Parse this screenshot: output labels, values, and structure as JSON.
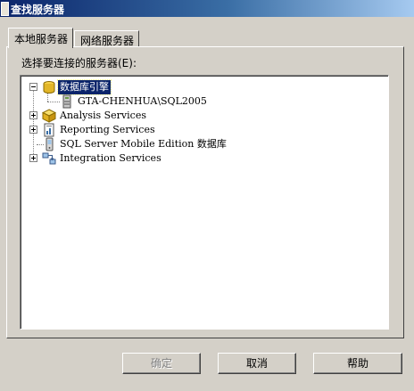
{
  "window": {
    "title": "查找服务器"
  },
  "tabs": [
    {
      "label": "本地服务器",
      "active": true
    },
    {
      "label": "网络服务器",
      "active": false
    }
  ],
  "prompt": {
    "label": "选择要连接的服务器(E):"
  },
  "tree": {
    "nodes": [
      {
        "label": "数据库引擎",
        "expanded": true,
        "selected": true,
        "icon": "database-engine-icon"
      },
      {
        "label": "GTA-CHENHUA\\SQL2005",
        "icon": "server-icon"
      },
      {
        "label": "Analysis Services",
        "expanded": false,
        "icon": "analysis-services-icon"
      },
      {
        "label": "Reporting Services",
        "expanded": false,
        "icon": "reporting-services-icon"
      },
      {
        "label": "SQL Server Mobile Edition 数据库",
        "icon": "mobile-database-icon"
      },
      {
        "label": "Integration Services",
        "expanded": false,
        "icon": "integration-services-icon"
      }
    ]
  },
  "buttons": {
    "ok_label": "确定",
    "cancel_label": "取消",
    "help_label": "帮助"
  },
  "colors": {
    "selection": "#0a246a",
    "face": "#d4d0c8",
    "titlebar": "#0a246a"
  }
}
